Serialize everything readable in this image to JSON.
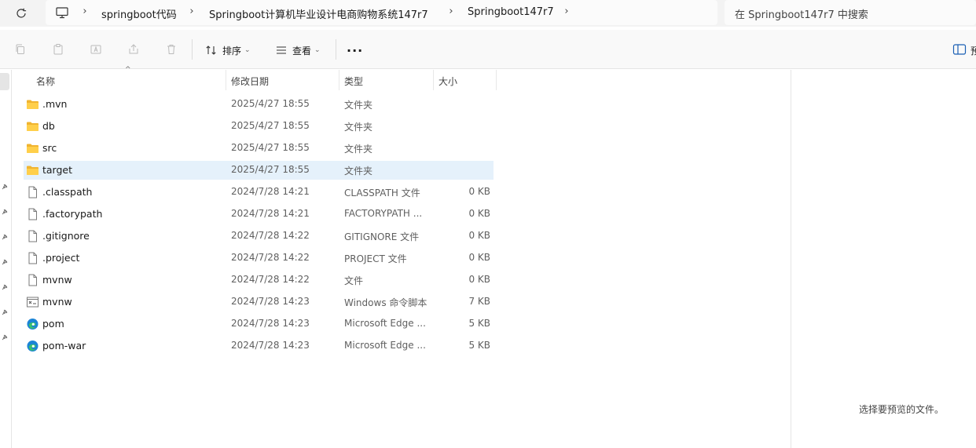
{
  "breadcrumb": [
    "springboot代码",
    "Springboot计算机毕业设计电商购物系统147r7",
    "Springboot147r7"
  ],
  "search": {
    "placeholder": "在 Springboot147r7 中搜索"
  },
  "toolbar": {
    "sort_label": "排序",
    "view_label": "查看",
    "more_label": "···",
    "details_label": "预"
  },
  "columns": {
    "name": "名称",
    "date": "修改日期",
    "type": "类型",
    "size": "大小"
  },
  "files": [
    {
      "name": ".mvn",
      "date": "2025/4/27 18:55",
      "type": "文件夹",
      "size": "",
      "icon": "folder-icon"
    },
    {
      "name": "db",
      "date": "2025/4/27 18:55",
      "type": "文件夹",
      "size": "",
      "icon": "folder-icon"
    },
    {
      "name": "src",
      "date": "2025/4/27 18:55",
      "type": "文件夹",
      "size": "",
      "icon": "folder-icon"
    },
    {
      "name": "target",
      "date": "2025/4/27 18:55",
      "type": "文件夹",
      "size": "",
      "icon": "folder-icon",
      "selected": true
    },
    {
      "name": ".classpath",
      "date": "2024/7/28 14:21",
      "type": "CLASSPATH 文件",
      "size": "0 KB",
      "icon": "file-icon"
    },
    {
      "name": ".factorypath",
      "date": "2024/7/28 14:21",
      "type": "FACTORYPATH ...",
      "size": "0 KB",
      "icon": "file-icon"
    },
    {
      "name": ".gitignore",
      "date": "2024/7/28 14:22",
      "type": "GITIGNORE 文件",
      "size": "0 KB",
      "icon": "file-icon"
    },
    {
      "name": ".project",
      "date": "2024/7/28 14:22",
      "type": "PROJECT 文件",
      "size": "0 KB",
      "icon": "file-icon"
    },
    {
      "name": "mvnw",
      "date": "2024/7/28 14:22",
      "type": "文件",
      "size": "0 KB",
      "icon": "file-icon"
    },
    {
      "name": "mvnw",
      "date": "2024/7/28 14:23",
      "type": "Windows 命令脚本",
      "size": "7 KB",
      "icon": "script-icon"
    },
    {
      "name": "pom",
      "date": "2024/7/28 14:23",
      "type": "Microsoft Edge ...",
      "size": "5 KB",
      "icon": "edge-icon"
    },
    {
      "name": "pom-war",
      "date": "2024/7/28 14:23",
      "type": "Microsoft Edge ...",
      "size": "5 KB",
      "icon": "edge-icon"
    }
  ],
  "preview": {
    "message": "选择要预览的文件。"
  }
}
